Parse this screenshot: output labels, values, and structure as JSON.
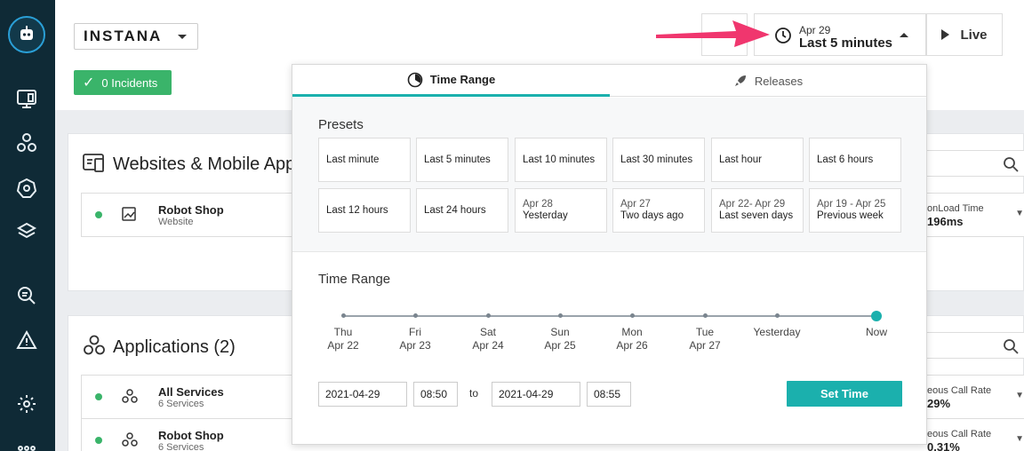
{
  "header": {
    "brand": "INSTANA",
    "incidents_label": "0 Incidents",
    "time_button": {
      "date": "Apr 29",
      "range": "Last 5 minutes"
    },
    "live_label": "Live"
  },
  "cards": {
    "websites": {
      "title": "Websites & Mobile App",
      "rows": [
        {
          "name": "Robot Shop",
          "sub": "Website",
          "metric_label": "onLoad Time",
          "metric_value": "196ms"
        }
      ]
    },
    "applications": {
      "title": "Applications (2)",
      "rows": [
        {
          "name": "All Services",
          "sub": "6 Services",
          "metric_label": "eous Call Rate",
          "metric_value": "29%"
        },
        {
          "name": "Robot Shop",
          "sub": "6 Services",
          "metric_label": "eous Call Rate",
          "metric_value": "0.31%"
        }
      ]
    }
  },
  "popover": {
    "tabs": {
      "time_range": "Time Range",
      "releases": "Releases"
    },
    "presets_title": "Presets",
    "presets": [
      {
        "date": "",
        "label": "Last minute"
      },
      {
        "date": "",
        "label": "Last 5 minutes"
      },
      {
        "date": "",
        "label": "Last 10 minutes"
      },
      {
        "date": "",
        "label": "Last 30 minutes"
      },
      {
        "date": "",
        "label": "Last hour"
      },
      {
        "date": "",
        "label": "Last 6 hours"
      },
      {
        "date": "",
        "label": "Last 12 hours"
      },
      {
        "date": "",
        "label": "Last 24 hours"
      },
      {
        "date": "Apr 28",
        "label": "Yesterday"
      },
      {
        "date": "Apr 27",
        "label": "Two days ago"
      },
      {
        "date": "Apr 22- Apr 29",
        "label": "Last seven days"
      },
      {
        "date": "Apr 19 - Apr 25",
        "label": "Previous week"
      }
    ],
    "range_title": "Time Range",
    "timeline": [
      {
        "day": "Thu",
        "date": "Apr 22"
      },
      {
        "day": "Fri",
        "date": "Apr 23"
      },
      {
        "day": "Sat",
        "date": "Apr 24"
      },
      {
        "day": "Sun",
        "date": "Apr 25"
      },
      {
        "day": "Mon",
        "date": "Apr 26"
      },
      {
        "day": "Tue",
        "date": "Apr 27"
      },
      {
        "day": "Yesterday",
        "date": ""
      },
      {
        "day": "Now",
        "date": ""
      }
    ],
    "from_date": "2021-04-29",
    "from_time": "08:50",
    "to_label": "to",
    "to_date": "2021-04-29",
    "to_time": "08:55",
    "set_time_label": "Set Time"
  },
  "colors": {
    "accent": "#1bb0ad",
    "success": "#3ab46a",
    "sidebar": "#0f2a36",
    "annotation_arrow": "#f0366e"
  }
}
